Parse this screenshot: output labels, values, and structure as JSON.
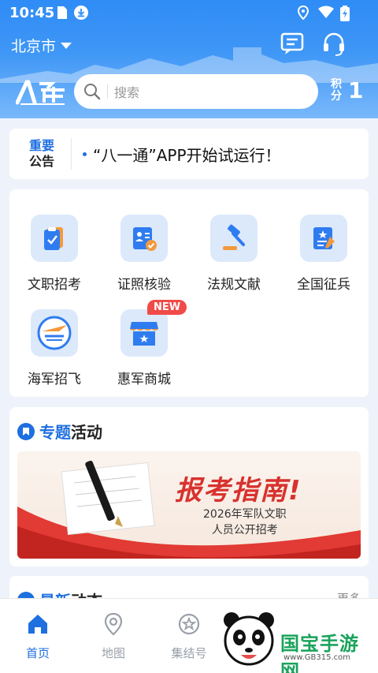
{
  "status_bar": {
    "time": "10:45"
  },
  "header": {
    "city": "北京市",
    "search_placeholder": "搜索",
    "points_label": "积分",
    "points_value": "1",
    "logo_text": "八一通"
  },
  "notice": {
    "badge_line1": "重要",
    "badge_line2": "公告",
    "text": "“八一通”APP开始试运行！"
  },
  "services": [
    {
      "label": "文职招考",
      "icon": "exam-icon"
    },
    {
      "label": "证照核验",
      "icon": "id-verify-icon"
    },
    {
      "label": "法规文献",
      "icon": "gavel-icon"
    },
    {
      "label": "全国征兵",
      "icon": "conscription-icon"
    },
    {
      "label": "海军招飞",
      "icon": "navy-pilot-icon"
    },
    {
      "label": "惠军商城",
      "icon": "store-icon",
      "badge": "NEW"
    }
  ],
  "topic": {
    "title_part1": "专题",
    "title_part2": "活动",
    "banner_title": "报考指南!",
    "banner_sub1": "2026年军队文职",
    "banner_sub2": "人员公开招考"
  },
  "news": {
    "title_part1": "最新",
    "title_part2": "动态",
    "more": "更多"
  },
  "tabs": [
    {
      "label": "首页",
      "active": true
    },
    {
      "label": "地图",
      "active": false
    },
    {
      "label": "集结号",
      "active": false
    }
  ],
  "watermark": {
    "text": "国宝手游网",
    "url": "www.GB315.com"
  },
  "colors": {
    "primary": "#1e6fe0",
    "header": "#3f97f6",
    "accent_red": "#d8322e"
  }
}
